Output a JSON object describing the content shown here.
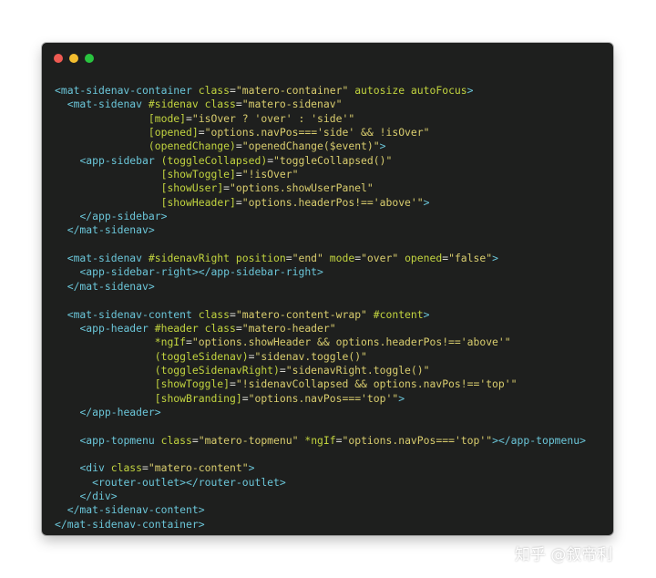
{
  "window": {
    "controls": [
      {
        "name": "close",
        "color": "#ee5a52"
      },
      {
        "name": "minimize",
        "color": "#f3bd2f"
      },
      {
        "name": "maximize",
        "color": "#29c33f"
      }
    ]
  },
  "colors": {
    "background": "#1e1f1e",
    "tag": "#6bc6d9",
    "attribute": "#c2d43f",
    "string": "#d9cd6e",
    "text": "#d8d8d2"
  },
  "code_lines": [
    [
      {
        "t": "tag",
        "v": "<mat-sidenav-container "
      },
      {
        "t": "attr",
        "v": "class"
      },
      {
        "t": "plain",
        "v": "="
      },
      {
        "t": "str",
        "v": "\"matero-container\""
      },
      {
        "t": "plain",
        "v": " "
      },
      {
        "t": "attr",
        "v": "autosize autoFocus"
      },
      {
        "t": "tag",
        "v": ">"
      }
    ],
    [
      {
        "t": "plain",
        "v": "  "
      },
      {
        "t": "tag",
        "v": "<mat-sidenav "
      },
      {
        "t": "attr",
        "v": "#sidenav class"
      },
      {
        "t": "plain",
        "v": "="
      },
      {
        "t": "str",
        "v": "\"matero-sidenav\""
      }
    ],
    [
      {
        "t": "plain",
        "v": "               "
      },
      {
        "t": "attr",
        "v": "[mode]"
      },
      {
        "t": "plain",
        "v": "="
      },
      {
        "t": "str",
        "v": "\"isOver ? 'over' : 'side'\""
      }
    ],
    [
      {
        "t": "plain",
        "v": "               "
      },
      {
        "t": "attr",
        "v": "[opened]"
      },
      {
        "t": "plain",
        "v": "="
      },
      {
        "t": "str",
        "v": "\"options.navPos==='side' && !isOver\""
      }
    ],
    [
      {
        "t": "plain",
        "v": "               "
      },
      {
        "t": "attr",
        "v": "(openedChange)"
      },
      {
        "t": "plain",
        "v": "="
      },
      {
        "t": "str",
        "v": "\"openedChange($event)\""
      },
      {
        "t": "tag",
        "v": ">"
      }
    ],
    [
      {
        "t": "plain",
        "v": "    "
      },
      {
        "t": "tag",
        "v": "<app-sidebar "
      },
      {
        "t": "attr",
        "v": "(toggleCollapsed)"
      },
      {
        "t": "plain",
        "v": "="
      },
      {
        "t": "str",
        "v": "\"toggleCollapsed()\""
      }
    ],
    [
      {
        "t": "plain",
        "v": "                 "
      },
      {
        "t": "attr",
        "v": "[showToggle]"
      },
      {
        "t": "plain",
        "v": "="
      },
      {
        "t": "str",
        "v": "\"!isOver\""
      }
    ],
    [
      {
        "t": "plain",
        "v": "                 "
      },
      {
        "t": "attr",
        "v": "[showUser]"
      },
      {
        "t": "plain",
        "v": "="
      },
      {
        "t": "str",
        "v": "\"options.showUserPanel\""
      }
    ],
    [
      {
        "t": "plain",
        "v": "                 "
      },
      {
        "t": "attr",
        "v": "[showHeader]"
      },
      {
        "t": "plain",
        "v": "="
      },
      {
        "t": "str",
        "v": "\"options.headerPos!=='above'\""
      },
      {
        "t": "tag",
        "v": ">"
      }
    ],
    [
      {
        "t": "plain",
        "v": "    "
      },
      {
        "t": "tag",
        "v": "</app-sidebar>"
      }
    ],
    [
      {
        "t": "plain",
        "v": "  "
      },
      {
        "t": "tag",
        "v": "</mat-sidenav>"
      }
    ],
    [],
    [
      {
        "t": "plain",
        "v": "  "
      },
      {
        "t": "tag",
        "v": "<mat-sidenav "
      },
      {
        "t": "attr",
        "v": "#sidenavRight position"
      },
      {
        "t": "plain",
        "v": "="
      },
      {
        "t": "str",
        "v": "\"end\""
      },
      {
        "t": "plain",
        "v": " "
      },
      {
        "t": "attr",
        "v": "mode"
      },
      {
        "t": "plain",
        "v": "="
      },
      {
        "t": "str",
        "v": "\"over\""
      },
      {
        "t": "plain",
        "v": " "
      },
      {
        "t": "attr",
        "v": "opened"
      },
      {
        "t": "plain",
        "v": "="
      },
      {
        "t": "str",
        "v": "\"false\""
      },
      {
        "t": "tag",
        "v": ">"
      }
    ],
    [
      {
        "t": "plain",
        "v": "    "
      },
      {
        "t": "tag",
        "v": "<app-sidebar-right></app-sidebar-right>"
      }
    ],
    [
      {
        "t": "plain",
        "v": "  "
      },
      {
        "t": "tag",
        "v": "</mat-sidenav>"
      }
    ],
    [],
    [
      {
        "t": "plain",
        "v": "  "
      },
      {
        "t": "tag",
        "v": "<mat-sidenav-content "
      },
      {
        "t": "attr",
        "v": "class"
      },
      {
        "t": "plain",
        "v": "="
      },
      {
        "t": "str",
        "v": "\"matero-content-wrap\""
      },
      {
        "t": "plain",
        "v": " "
      },
      {
        "t": "attr",
        "v": "#content"
      },
      {
        "t": "tag",
        "v": ">"
      }
    ],
    [
      {
        "t": "plain",
        "v": "    "
      },
      {
        "t": "tag",
        "v": "<app-header "
      },
      {
        "t": "attr",
        "v": "#header class"
      },
      {
        "t": "plain",
        "v": "="
      },
      {
        "t": "str",
        "v": "\"matero-header\""
      }
    ],
    [
      {
        "t": "plain",
        "v": "                "
      },
      {
        "t": "attr",
        "v": "*ngIf"
      },
      {
        "t": "plain",
        "v": "="
      },
      {
        "t": "str",
        "v": "\"options.showHeader && options.headerPos!=='above'\""
      }
    ],
    [
      {
        "t": "plain",
        "v": "                "
      },
      {
        "t": "attr",
        "v": "(toggleSidenav)"
      },
      {
        "t": "plain",
        "v": "="
      },
      {
        "t": "str",
        "v": "\"sidenav.toggle()\""
      }
    ],
    [
      {
        "t": "plain",
        "v": "                "
      },
      {
        "t": "attr",
        "v": "(toggleSidenavRight)"
      },
      {
        "t": "plain",
        "v": "="
      },
      {
        "t": "str",
        "v": "\"sidenavRight.toggle()\""
      }
    ],
    [
      {
        "t": "plain",
        "v": "                "
      },
      {
        "t": "attr",
        "v": "[showToggle]"
      },
      {
        "t": "plain",
        "v": "="
      },
      {
        "t": "str",
        "v": "\"!sidenavCollapsed && options.navPos!=='top'\""
      }
    ],
    [
      {
        "t": "plain",
        "v": "                "
      },
      {
        "t": "attr",
        "v": "[showBranding]"
      },
      {
        "t": "plain",
        "v": "="
      },
      {
        "t": "str",
        "v": "\"options.navPos==='top'\""
      },
      {
        "t": "tag",
        "v": ">"
      }
    ],
    [
      {
        "t": "plain",
        "v": "    "
      },
      {
        "t": "tag",
        "v": "</app-header>"
      }
    ],
    [],
    [
      {
        "t": "plain",
        "v": "    "
      },
      {
        "t": "tag",
        "v": "<app-topmenu "
      },
      {
        "t": "attr",
        "v": "class"
      },
      {
        "t": "plain",
        "v": "="
      },
      {
        "t": "str",
        "v": "\"matero-topmenu\""
      },
      {
        "t": "plain",
        "v": " "
      },
      {
        "t": "attr",
        "v": "*ngIf"
      },
      {
        "t": "plain",
        "v": "="
      },
      {
        "t": "str",
        "v": "\"options.navPos==='top'\""
      },
      {
        "t": "tag",
        "v": "></app-topmenu>"
      }
    ],
    [],
    [
      {
        "t": "plain",
        "v": "    "
      },
      {
        "t": "tag",
        "v": "<div "
      },
      {
        "t": "attr",
        "v": "class"
      },
      {
        "t": "plain",
        "v": "="
      },
      {
        "t": "str",
        "v": "\"matero-content\""
      },
      {
        "t": "tag",
        "v": ">"
      }
    ],
    [
      {
        "t": "plain",
        "v": "      "
      },
      {
        "t": "tag",
        "v": "<router-outlet></router-outlet>"
      }
    ],
    [
      {
        "t": "plain",
        "v": "    "
      },
      {
        "t": "tag",
        "v": "</div>"
      }
    ],
    [
      {
        "t": "plain",
        "v": "  "
      },
      {
        "t": "tag",
        "v": "</mat-sidenav-content>"
      }
    ],
    [
      {
        "t": "tag",
        "v": "</mat-sidenav-container>"
      }
    ]
  ],
  "watermark": "知乎 @叙帝利"
}
